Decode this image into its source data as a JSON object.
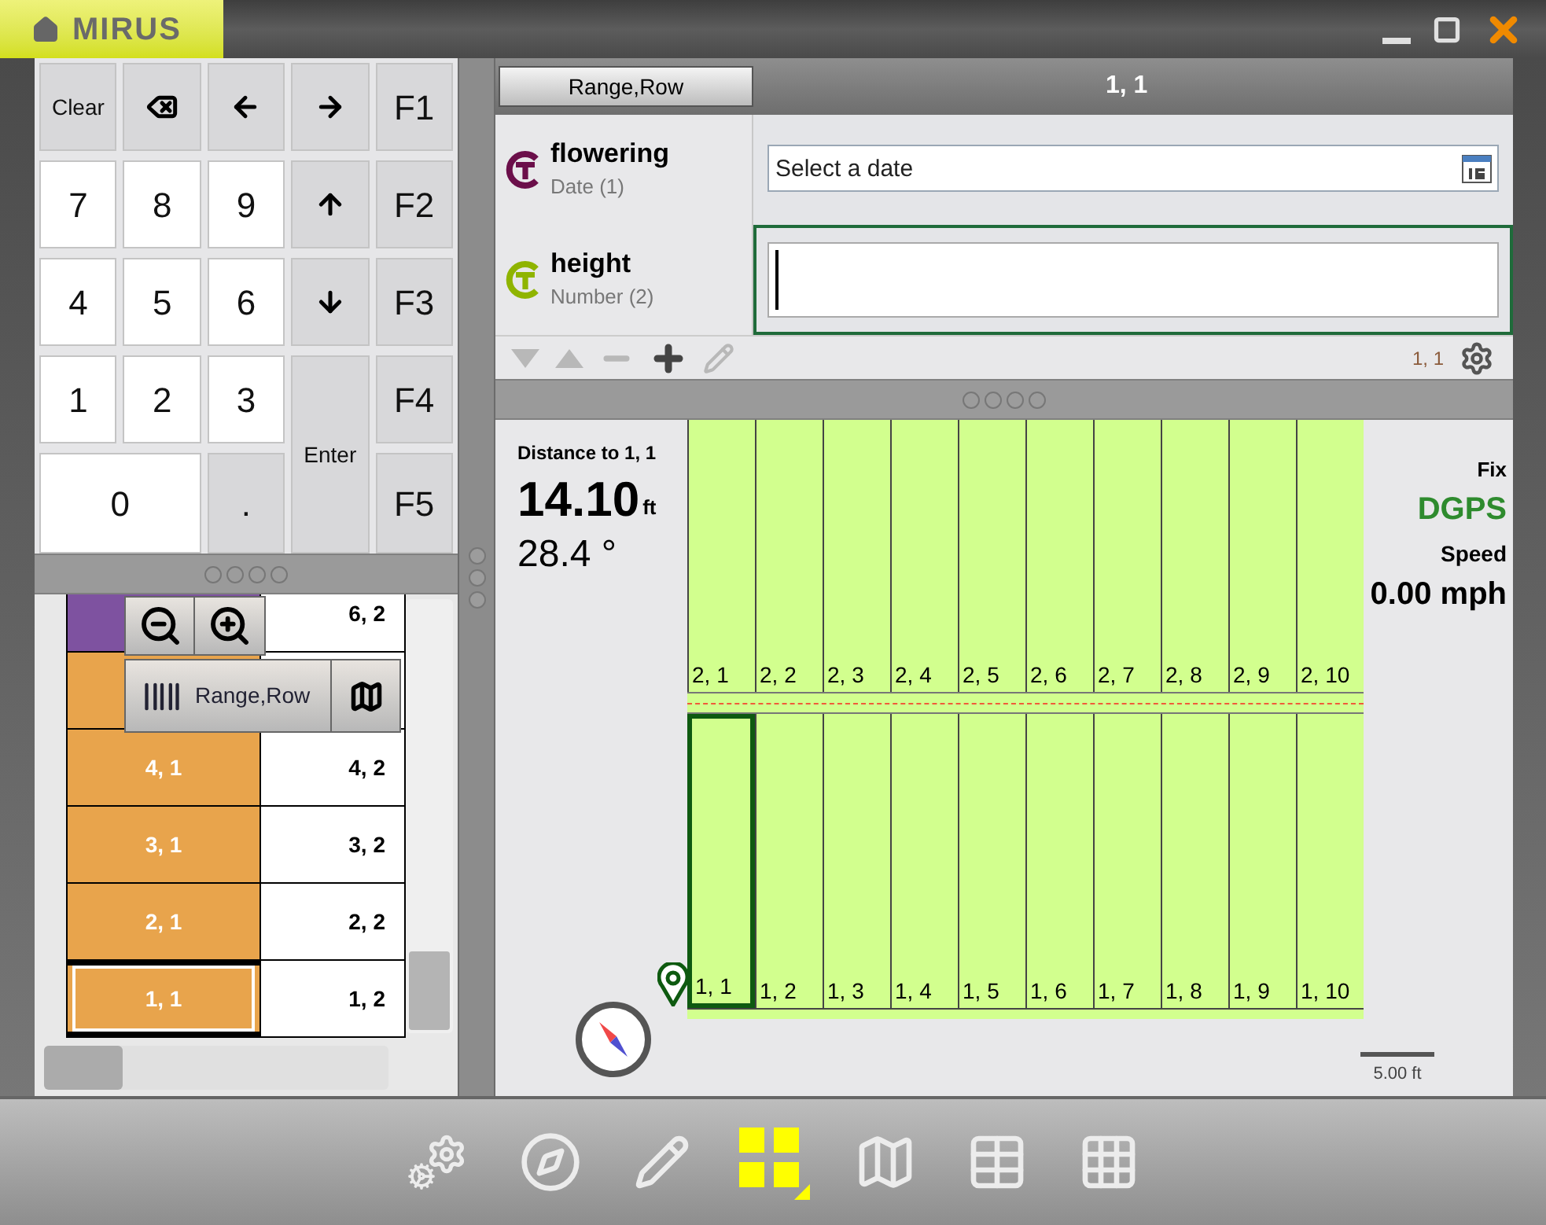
{
  "title_bar": {
    "logo": "MIRUS"
  },
  "keypad": {
    "keys": [
      {
        "kind": "action",
        "label": "Clear"
      },
      {
        "kind": "backspace"
      },
      {
        "kind": "arrow-left"
      },
      {
        "kind": "arrow-right"
      },
      {
        "kind": "function",
        "label": "F1"
      },
      {
        "kind": "digit",
        "label": "7"
      },
      {
        "kind": "digit",
        "label": "8"
      },
      {
        "kind": "digit",
        "label": "9"
      },
      {
        "kind": "arrow-up"
      },
      {
        "kind": "function",
        "label": "F2"
      },
      {
        "kind": "digit",
        "label": "4"
      },
      {
        "kind": "digit",
        "label": "5"
      },
      {
        "kind": "digit",
        "label": "6"
      },
      {
        "kind": "arrow-down"
      },
      {
        "kind": "function",
        "label": "F3"
      },
      {
        "kind": "digit",
        "label": "1"
      },
      {
        "kind": "digit",
        "label": "2"
      },
      {
        "kind": "digit",
        "label": "3"
      },
      {
        "kind": "enter",
        "label": "Enter"
      },
      {
        "kind": "function",
        "label": "F4"
      },
      {
        "kind": "wide-digit",
        "label": "0"
      },
      {
        "kind": "function",
        "label": "."
      },
      {
        "kind": "function",
        "label": "F5"
      }
    ]
  },
  "plot_list": {
    "rows": [
      {
        "left": {
          "color": "#7e52a0"
        },
        "right": "6, 2",
        "selected": false
      },
      {
        "left": {
          "color": "#e8a44c"
        },
        "selected": false
      },
      {
        "left": {
          "text": "4, 1",
          "color": "#e8a44c"
        },
        "right": "4, 2",
        "selected": false
      },
      {
        "left": {
          "text": "3, 1",
          "color": "#e8a44c"
        },
        "right": "3, 2",
        "selected": false
      },
      {
        "left": {
          "text": "2, 1",
          "color": "#e8a44c"
        },
        "right": "2, 2",
        "selected": false
      },
      {
        "left": {
          "text": "1, 1",
          "color": "#e8a44c"
        },
        "right": "1, 2",
        "selected": true
      }
    ],
    "overlay": {
      "range_row_button": "Range,Row"
    }
  },
  "record": {
    "header_button": "Range,Row",
    "title": "1, 1",
    "attributes": [
      {
        "kind": "date",
        "name": "flowering",
        "type": "Date (1)",
        "color": "#6b0f4a",
        "placeholder": "Select a date",
        "selected": false
      },
      {
        "kind": "number",
        "name": "height",
        "type": "Number (2)",
        "color": "#8fb400",
        "selected": true
      }
    ],
    "position": "1, 1"
  },
  "map": {
    "distance_label": "Distance to 1, 1",
    "distance": "14.10",
    "distance_unit": "ft",
    "angle": "28.4 °",
    "fix_label": "Fix",
    "fix": "DGPS",
    "speed_label": "Speed",
    "speed": "0.00 mph",
    "scale": "5.00 ft",
    "rows": [
      {
        "plots": [
          {
            "label": "2, 1",
            "selected": false
          },
          {
            "label": "2, 2",
            "selected": false
          },
          {
            "label": "2, 3",
            "selected": false
          },
          {
            "label": "2, 4",
            "selected": false
          },
          {
            "label": "2, 5",
            "selected": false
          },
          {
            "label": "2, 6",
            "selected": false
          },
          {
            "label": "2, 7",
            "selected": false
          },
          {
            "label": "2, 8",
            "selected": false
          },
          {
            "label": "2, 9",
            "selected": false
          },
          {
            "label": "2, 10",
            "selected": false
          }
        ]
      },
      {
        "plots": [
          {
            "label": "1, 1",
            "selected": true
          },
          {
            "label": "1, 2",
            "selected": false
          },
          {
            "label": "1, 3",
            "selected": false
          },
          {
            "label": "1, 4",
            "selected": false
          },
          {
            "label": "1, 5",
            "selected": false
          },
          {
            "label": "1, 6",
            "selected": false
          },
          {
            "label": "1, 7",
            "selected": false
          },
          {
            "label": "1, 8",
            "selected": false
          },
          {
            "label": "1, 9",
            "selected": false
          },
          {
            "label": "1, 10",
            "selected": false
          }
        ]
      }
    ]
  },
  "bottom_toolbar": {
    "items": [
      {
        "kind": "gears",
        "selected": false
      },
      {
        "kind": "compass",
        "selected": false
      },
      {
        "kind": "pencil",
        "selected": false
      },
      {
        "kind": "tiles",
        "selected": true
      },
      {
        "kind": "map",
        "selected": false
      },
      {
        "kind": "table",
        "selected": false
      },
      {
        "kind": "keypad",
        "selected": false
      }
    ]
  }
}
